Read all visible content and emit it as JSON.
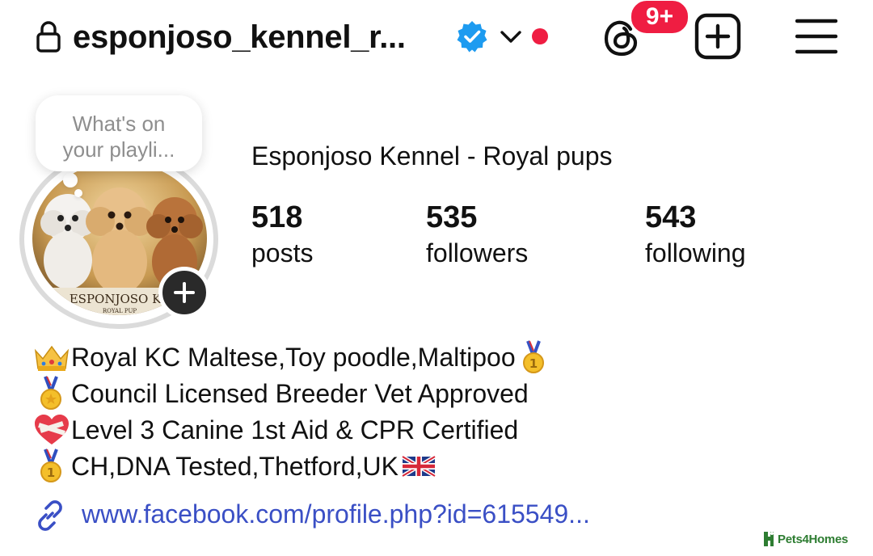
{
  "header": {
    "username": "esponjoso_kennel_r...",
    "notification_badge": "9+",
    "lock_icon": "lock-icon",
    "verified_icon": "verified-badge-icon",
    "dropdown_icon": "chevron-down-icon",
    "threads_icon": "threads-icon",
    "add_icon": "plus-square-icon",
    "menu_icon": "hamburger-menu-icon",
    "dot_color": "#ef1d42",
    "verified_color": "#1d9bf0"
  },
  "profile": {
    "note_line1": "What's on",
    "note_line2": "your playli...",
    "avatar_caption": "ESPONJOSO KE",
    "avatar_subcaption": "ROYAL PUP",
    "display_name": "Esponjoso Kennel - Royal pups",
    "stats": {
      "posts_count": "518",
      "posts_label": "posts",
      "followers_count": "535",
      "followers_label": "followers",
      "following_count": "543",
      "following_label": "following"
    }
  },
  "bio": {
    "line1": "Royal KC Maltese,Toy poodle,Maltipoo",
    "line2": "Council Licensed Breeder Vet Approved",
    "line3": "Level 3 Canine 1st Aid & CPR Certified",
    "line4": "CH,DNA Tested,Thetford,UK",
    "link": "www.facebook.com/profile.php?id=615549...",
    "link_color": "#3a4fc5"
  },
  "watermark": {
    "text": "Pets4Homes",
    "color": "#2e7d32"
  }
}
